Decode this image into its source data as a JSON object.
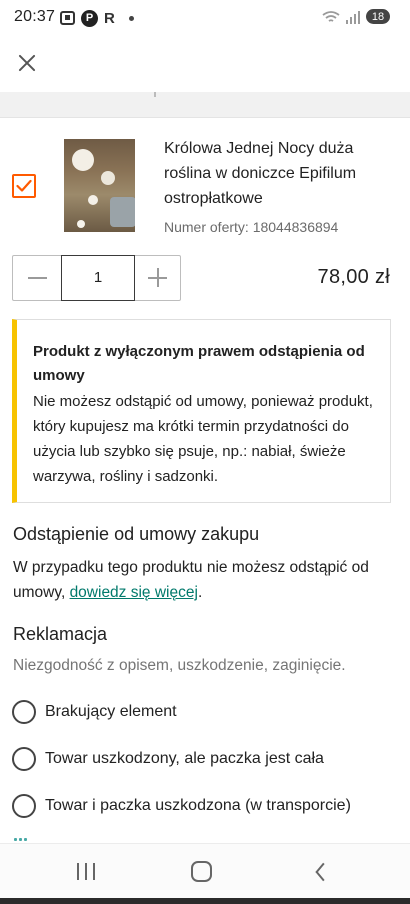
{
  "status_bar": {
    "time": "20:37",
    "r_label": "R",
    "battery": "18",
    "icons": [
      "screenshot-icon",
      "parking-app-icon",
      "notification-dot",
      "wifi-icon",
      "signal-icon",
      "battery-icon"
    ]
  },
  "top_bar": {
    "close_icon": "close-icon"
  },
  "product": {
    "checked": true,
    "title": "Królowa Jednej Nocy duża roślina w doniczce Epifilum ostropłatkowe",
    "offer_number": "Numer oferty: 18044836894",
    "quantity": "1",
    "price": "78,00 zł"
  },
  "notice": {
    "title": "Produkt z wyłączonym prawem odstąpienia od umowy",
    "body": "Nie możesz odstąpić od umowy, ponieważ produkt, który kupujesz ma krótki termin przydatności do użycia lub szybko się psuje, np.: nabiał, świeże warzywa, rośliny i sadzonki.",
    "accent_color": "#f7c300"
  },
  "withdrawal": {
    "heading": "Odstąpienie od umowy zakupu",
    "text": "W przypadku tego produktu nie możesz odstąpić od umowy, ",
    "link": "dowiedz się więcej",
    "text_end": "."
  },
  "complaint": {
    "heading": "Reklamacja",
    "subtitle": "Niezgodność z opisem, uszkodzenie, zaginięcie.",
    "options": [
      "Brakujący element",
      "Towar uszkodzony, ale paczka jest cała",
      "Towar i paczka uszkodzona (w transporcie)"
    ]
  },
  "colors": {
    "checkbox": "#ff5a00",
    "link": "#00796b"
  }
}
